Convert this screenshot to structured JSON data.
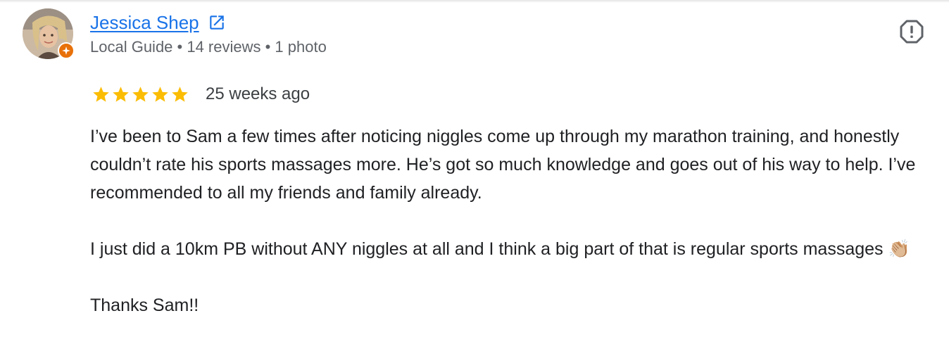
{
  "review": {
    "author": {
      "name": "Jessica Shep",
      "meta": "Local Guide • 14 reviews • 1 photo",
      "avatar_icon": "user-avatar-photo",
      "badge_icon": "local-guide-star-icon",
      "badge_color": "#e8710a"
    },
    "external_link_icon": "open-in-new-icon",
    "flag_icon": "report-flag-icon",
    "rating": 5,
    "star_color": "#fbbc04",
    "date": "25 weeks ago",
    "paragraphs": [
      "I’ve been to Sam a few times after noticing niggles come up through my marathon training, and honestly couldn’t rate his sports massages more. He’s got so much knowledge and goes out of his way to help. I’ve recommended to all my friends and family already.",
      "I just did a 10km PB without ANY niggles at all and I think a big part of that is regular sports massages 👏🏼",
      "Thanks Sam!!"
    ],
    "link_color": "#1a73e8"
  }
}
